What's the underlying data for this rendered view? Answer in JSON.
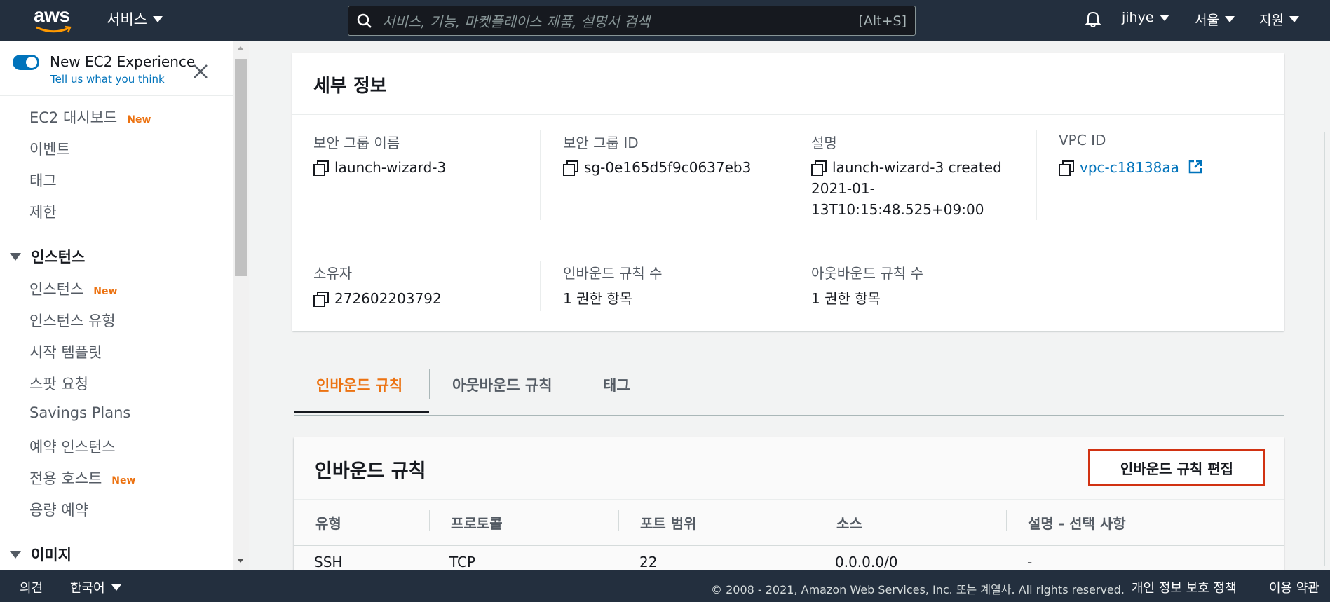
{
  "topnav": {
    "logo_text": "aws",
    "services_label": "서비스",
    "search_placeholder": "서비스, 기능, 마켓플레이스 제품, 설명서 검색",
    "search_shortcut": "[Alt+S]",
    "user": "jihye",
    "region": "서울",
    "support": "지원",
    "icons": [
      "search-icon",
      "bell-icon"
    ]
  },
  "sidebar": {
    "experience_title": "New EC2 Experience",
    "experience_link": "Tell us what you think",
    "new_badge": "New",
    "items": [
      {
        "label": "EC2 대시보드",
        "new": true
      },
      {
        "label": "이벤트"
      },
      {
        "label": "태그"
      },
      {
        "label": "제한"
      }
    ],
    "section_instances": "인스턴스",
    "instance_items": [
      {
        "label": "인스턴스",
        "new": true
      },
      {
        "label": "인스턴스 유형"
      },
      {
        "label": "시작 템플릿"
      },
      {
        "label": "스팟 요청"
      },
      {
        "label": "Savings Plans"
      },
      {
        "label": "예약 인스턴스"
      },
      {
        "label": "전용 호스트",
        "new": true
      },
      {
        "label": "용량 예약"
      }
    ],
    "section_images": "이미지"
  },
  "details": {
    "title": "세부 정보",
    "fields": {
      "sg_name_label": "보안 그룹 이름",
      "sg_name": "launch-wizard-3",
      "sg_id_label": "보안 그룹 ID",
      "sg_id": "sg-0e165d5f9c0637eb3",
      "desc_label": "설명",
      "desc_line1": "launch-wizard-3 created",
      "desc_line2": "2021-01-",
      "desc_line3": "13T10:15:48.525+09:00",
      "vpc_label": "VPC ID",
      "vpc": "vpc-c18138aa",
      "owner_label": "소유자",
      "owner": "272602203792",
      "inbound_count_label": "인바운드 규칙 수",
      "inbound_count": "1 권한 항목",
      "outbound_count_label": "아웃바운드 규칙 수",
      "outbound_count": "1 권한 항목"
    }
  },
  "tabs": [
    "인바운드 규칙",
    "아웃바운드 규칙",
    "태그"
  ],
  "inbound": {
    "title": "인바운드 규칙",
    "edit_button": "인바운드 규칙 편집",
    "columns": [
      "유형",
      "프로토콜",
      "포트 범위",
      "소스",
      "설명 - 선택 사항"
    ],
    "rows": [
      [
        "SSH",
        "TCP",
        "22",
        "0.0.0.0/0",
        "-"
      ]
    ]
  },
  "footer": {
    "feedback": "의견",
    "language": "한국어",
    "copyright": "© 2008 - 2021, Amazon Web Services, Inc. 또는 계열사. All rights reserved.",
    "privacy": "개인 정보 보호 정책",
    "terms": "이용 약관"
  },
  "colors": {
    "nav": "#232f3e",
    "accent": "#ec7211",
    "link": "#0073bb",
    "highlight": "#d13212"
  }
}
